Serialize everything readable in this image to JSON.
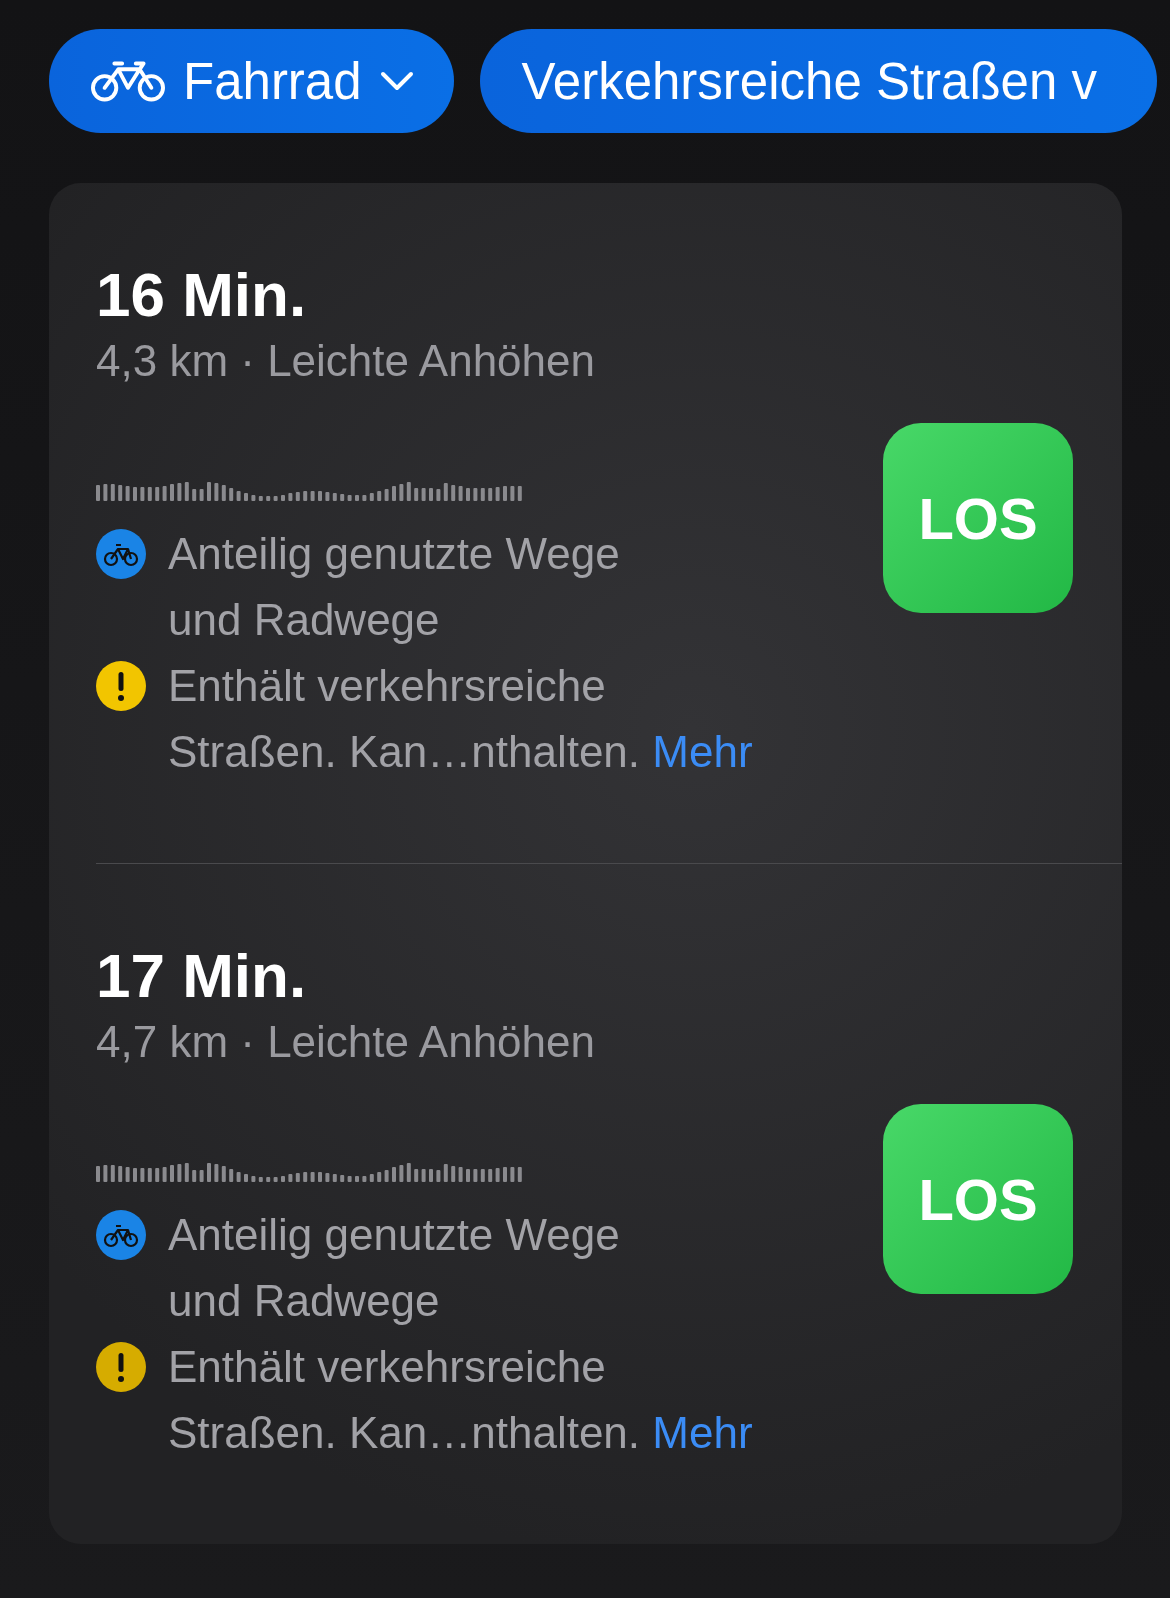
{
  "chips": [
    {
      "kind": "mode",
      "label": "Fahrrad"
    },
    {
      "kind": "filter",
      "label": "Verkehrsreiche Straßen v"
    }
  ],
  "routes": [
    {
      "duration": "16 Min.",
      "details": "4,3 km · Leichte Anhöhen",
      "button": "LOS",
      "notes": [
        {
          "kind": "bike",
          "text": "Anteilig genutzte Wege\nund Radwege"
        },
        {
          "kind": "warning",
          "text": "Enthält verkehrsreiche\nStraßen. Kan…nthalten.",
          "link": "Mehr"
        }
      ]
    },
    {
      "duration": "17 Min.",
      "details": "4,7 km · Leichte Anhöhen",
      "button": "LOS",
      "notes": [
        {
          "kind": "bike",
          "text": "Anteilig genutzte Wege\nund Radwege"
        },
        {
          "kind": "warning",
          "text": "Enthält verkehrsreiche\nStraßen. Kan…nthalten.",
          "link": "Mehr"
        }
      ]
    }
  ]
}
